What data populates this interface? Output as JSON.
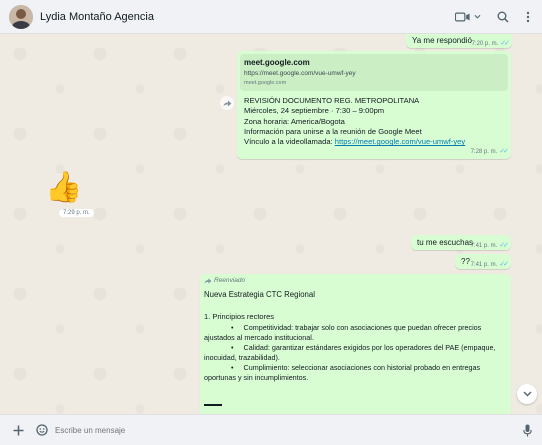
{
  "header": {
    "contact_name": "Lydia Montaño Agencia",
    "icons": [
      "video-camera-icon",
      "chevron-down-icon",
      "search-icon",
      "menu-icon"
    ]
  },
  "messages": {
    "m1": {
      "text": "Ya me respondió",
      "time": "7:20 p. m."
    },
    "m2": {
      "preview_title": "meet.google.com",
      "preview_url": "https://meet.google.com/vue-umwf-yey",
      "preview_domain": "meet.google.com",
      "line1": "REVISIÓN DOCUMENTO REG. METROPOLITANA",
      "line2": "Miércoles, 24 septiembre · 7:30 – 9:00pm",
      "line3": "Zona horaria: America/Bogota",
      "line4": "Información para unirse a la reunión de Google Meet",
      "line5_prefix": "Vínculo a la videollamada: ",
      "line5_link": "https://meet.google.com/vue-umwf-yey",
      "time": "7:28 p. m."
    },
    "m3": {
      "emoji": "👍",
      "time": "7:29 p. m."
    },
    "m4": {
      "text": "tu me escuchas",
      "time": "7:41 p. m."
    },
    "m5": {
      "text": "??",
      "time": "7:41 p. m."
    },
    "m6": {
      "forwarded_label": "Reenviado",
      "title": "Nueva Estrategia CTC Regional",
      "section": "1. Principios rectores",
      "bullet1": "Competitividad: trabajar solo con asociaciones que puedan ofrecer precios ajustados al mercado institucional.",
      "bullet2": "Calidad: garantizar estándares exigidos por los operadores del PAE (empaque, inocuidad, trazabilidad).",
      "bullet3": "Cumplimiento: seleccionar asociaciones con historial probado en entregas oportunas y sin incumplimientos.",
      "bullet_symbol": "•"
    }
  },
  "footer": {
    "placeholder": "Escribe un mensaje"
  },
  "colors": {
    "outgoing_bubble": "#d9fdd3",
    "incoming_bubble": "#ffffff",
    "read_ticks": "#53bdeb",
    "link": "#027eb5",
    "chat_background": "#efeae2"
  }
}
